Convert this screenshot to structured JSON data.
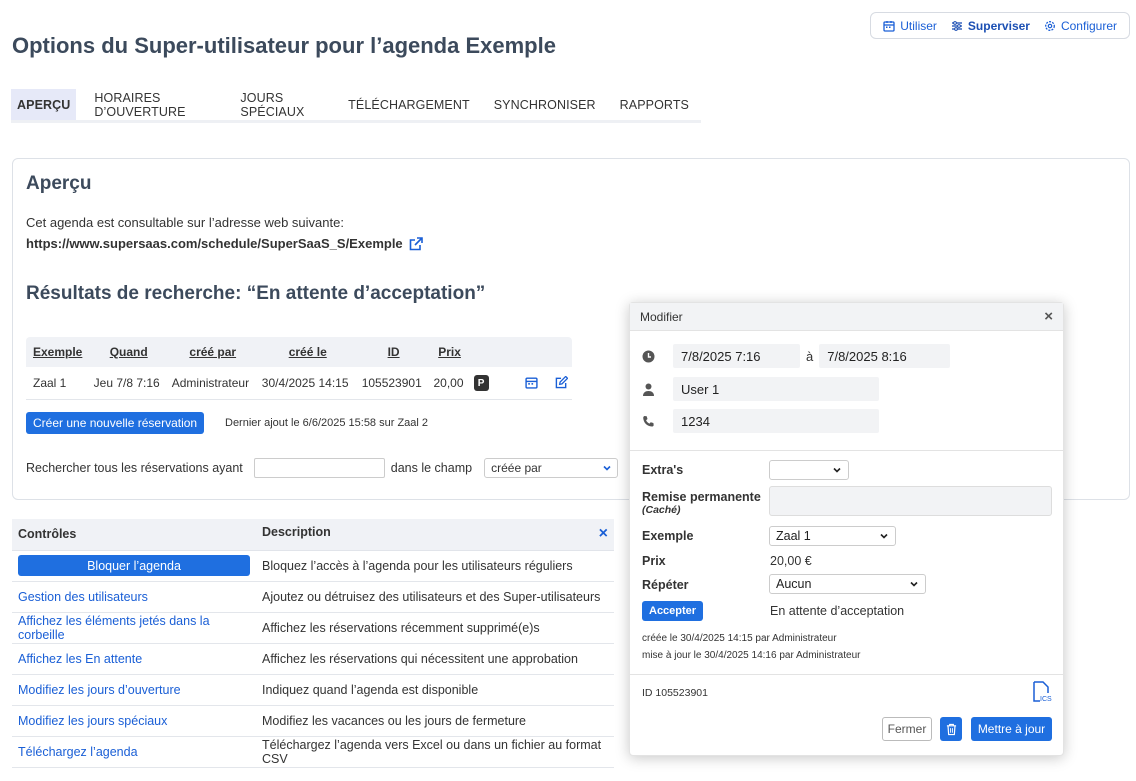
{
  "modes": [
    {
      "label": "Utiliser",
      "icon": "calendar-icon"
    },
    {
      "label": "Superviser",
      "icon": "sliders-icon"
    },
    {
      "label": "Configurer",
      "icon": "gear-icon"
    }
  ],
  "page_title": "Options du Super-utilisateur pour l’agenda Exemple",
  "tabs": [
    "APERÇU",
    "HORAIRES D’OUVERTURE",
    "JOURS SPÉCIAUX",
    "TÉLÉCHARGEMENT",
    "SYNCHRONISER",
    "RAPPORTS"
  ],
  "overview": {
    "title": "Aperçu",
    "intro": "Cet agenda est consultable sur l’adresse web suivante:",
    "url": "https://www.supersaas.com/schedule/SuperSaaS_S/Exemple"
  },
  "search_results": {
    "title": "Résultats de recherche: “En attente d’acceptation”",
    "columns": [
      "Exemple",
      "Quand",
      "créé par",
      "créé le",
      "ID",
      "Prix"
    ],
    "rows": [
      {
        "exemple": "Zaal 1",
        "quand": "Jeu 7/8 7:16",
        "cree_par": "Administrateur",
        "cree_le": "30/4/2025 14:15",
        "id": "105523901",
        "prix": "20,00",
        "badge": "P"
      }
    ],
    "create_button": "Créer une nouvelle réservation",
    "last_added": "Dernier ajout le 6/6/2025 15:58 sur Zaal 2",
    "search_label": "Rechercher tous les réservations ayant",
    "search_value": "",
    "field_label": "dans le champ",
    "field_selected": "créée par"
  },
  "controls": {
    "col1": "Contrôles",
    "col2": "Description",
    "rows": [
      {
        "action": "Bloquer l’agenda",
        "description": "Bloquez l’accès à l’agenda pour les utilisateurs réguliers"
      },
      {
        "action": "Gestion des utilisateurs",
        "description": "Ajoutez ou détruisez des utilisateurs et des Super-utilisateurs"
      },
      {
        "action": "Affichez les éléments jetés dans la corbeille",
        "description": "Affichez les réservations récemment supprimé(e)s"
      },
      {
        "action": "Affichez les En attente",
        "description": "Affichez les réservations qui nécessitent une approbation"
      },
      {
        "action": "Modifiez les jours d’ouverture",
        "description": "Indiquez quand l’agenda est disponible"
      },
      {
        "action": "Modifiez les jours spéciaux",
        "description": "Modifiez les vacances ou les jours de fermeture"
      },
      {
        "action": "Téléchargez l’agenda",
        "description": "Téléchargez l’agenda vers Excel ou dans un fichier au format CSV"
      }
    ]
  },
  "modal": {
    "title": "Modifier",
    "start": "7/8/2025  7:16",
    "to": "à",
    "end": "7/8/2025  8:16",
    "user": "User 1",
    "phone": "1234",
    "extras_label": "Extra's",
    "extras_value": "",
    "discount_label": "Remise permanente",
    "discount_hidden": "(Caché)",
    "discount_value": "",
    "resource_label": "Exemple",
    "resource_value": "Zaal 1",
    "price_label": "Prix",
    "price_value": "20,00 €",
    "repeat_label": "Répéter",
    "repeat_value": "Aucun",
    "accept_button": "Accepter",
    "status": "En attente d’acceptation",
    "created": "créée le 30/4/2025 14:15 par Administrateur",
    "updated": "mise à jour le 30/4/2025 14:16 par Administrateur",
    "id_text": "ID  105523901",
    "close_button": "Fermer",
    "update_button": "Mettre à jour"
  },
  "colors": {
    "accent": "#1f6fe0",
    "link": "#1a5fd6",
    "heading": "#3c4a5c"
  }
}
